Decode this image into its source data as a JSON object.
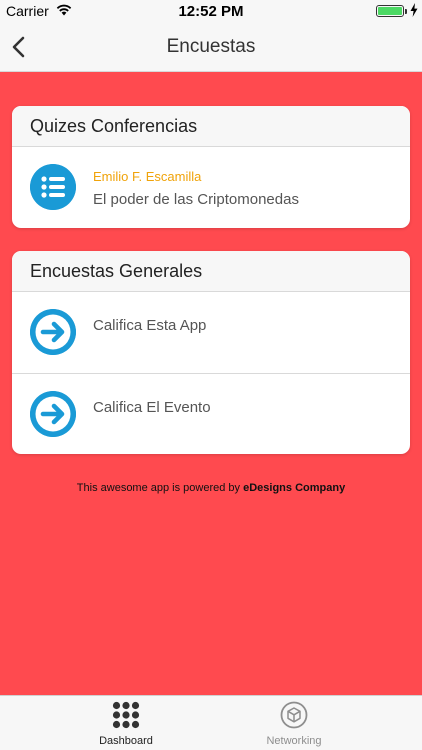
{
  "status_bar": {
    "carrier": "Carrier",
    "time": "12:52 PM"
  },
  "nav": {
    "title": "Encuestas"
  },
  "sections": [
    {
      "header": "Quizes Conferencias",
      "items": [
        {
          "subtitle": "Emilio F. Escamilla",
          "title": "El poder de las Criptomonedas",
          "icon": "list-icon"
        }
      ]
    },
    {
      "header": "Encuestas Generales",
      "items": [
        {
          "title": "Califica Esta App",
          "icon": "arrow-right-icon"
        },
        {
          "title": "Califica El Evento",
          "icon": "arrow-right-icon"
        }
      ]
    }
  ],
  "footer": {
    "prefix": "This awesome app is powered by ",
    "brand": "eDesigns Company"
  },
  "tabs": [
    {
      "label": "Dashboard",
      "icon": "grid-icon",
      "active": true
    },
    {
      "label": "Networking",
      "icon": "cube-icon",
      "active": false
    }
  ],
  "colors": {
    "background": "#ff4a4f",
    "accent": "#1a9ad6",
    "subtitle": "#f0a30a"
  }
}
